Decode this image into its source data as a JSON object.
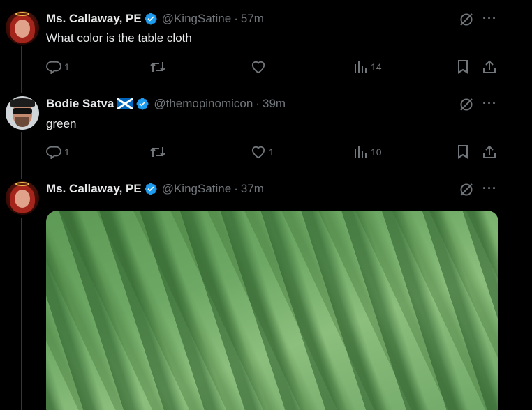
{
  "tweets": [
    {
      "name": "Ms. Callaway, PE",
      "handle": "@KingSatine",
      "time": "57m",
      "text": "What color is the table cloth",
      "actions": {
        "replies": "1",
        "retweets": "",
        "likes": "",
        "views": "14"
      },
      "avatar": "red-haired-halo-avatar"
    },
    {
      "name": "Bodie Satva",
      "handle": "@themopinomicon",
      "time": "39m",
      "text": "green",
      "actions": {
        "replies": "1",
        "retweets": "",
        "likes": "1",
        "views": "10"
      },
      "avatar": "sunglasses-avatar",
      "flag": "scotland-flag-icon"
    },
    {
      "name": "Ms. Callaway, PE",
      "handle": "@KingSatine",
      "time": "37m",
      "text": "",
      "media": "green-blurry-image",
      "avatar": "red-haired-halo-avatar"
    }
  ],
  "separator": "·",
  "more_label": "···",
  "colors": {
    "background": "#000000",
    "text": "#e7e9ea",
    "muted": "#71767b",
    "verified": "#1d9bf0",
    "thread_line": "#333639"
  }
}
